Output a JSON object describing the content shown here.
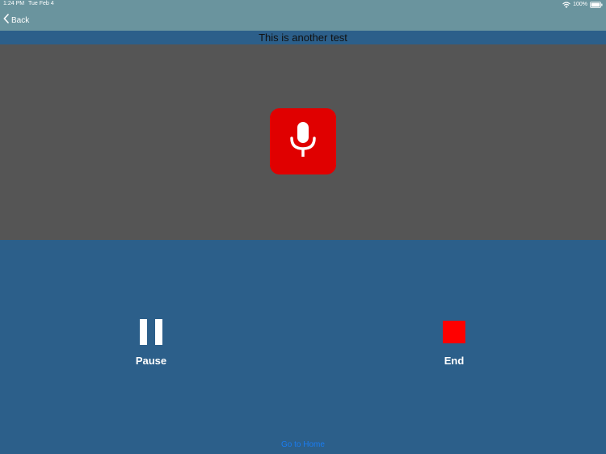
{
  "status_bar": {
    "time": "1:24 PM",
    "date": "Tue Feb 4",
    "battery": "100%",
    "icons": [
      "wifi-icon",
      "battery-icon"
    ]
  },
  "nav": {
    "back_label": "Back",
    "back_icon": "chevron-left-icon"
  },
  "recording": {
    "title": "This is another test",
    "mic_icon": "microphone-icon"
  },
  "controls": {
    "pause": {
      "label": "Pause",
      "icon": "pause-icon"
    },
    "end": {
      "label": "End",
      "icon": "stop-icon"
    }
  },
  "footer": {
    "home_link": "Go to Home"
  },
  "colors": {
    "top_bar": "#6a949e",
    "background": "#2c5f8a",
    "mic_panel": "#555555",
    "mic_button": "#e00000",
    "stop_square": "#ff0000",
    "link": "#1a7cf0"
  }
}
